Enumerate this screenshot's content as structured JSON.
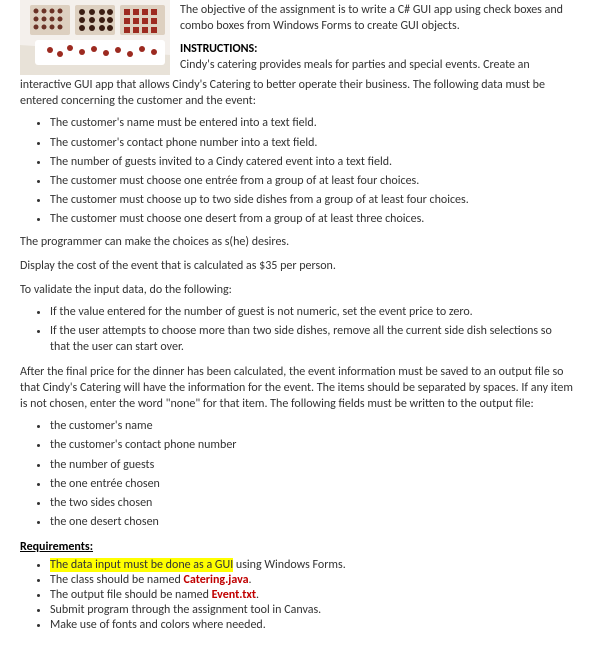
{
  "objective": {
    "text": "The objective of the assignment is to write a C# GUI app using check boxes and combo boxes from Windows Forms to create GUI objects."
  },
  "instructions": {
    "heading": "INSTRUCTIONS:",
    "line1": "Cindy's catering provides meals for parties and special events. Create an",
    "line2": "interactive GUI app that allows Cindy's Catering to better operate their business. The following data must be entered concerning the customer and the event:"
  },
  "data_points": [
    "The customer's name must be entered into a text field.",
    "The customer's contact phone number into a text field.",
    "The number of guests invited to a Cindy catered event into a text field.",
    "The customer must choose one entrée from a group of at least four choices.",
    "The customer must choose up to two side dishes from a group of at least four choices.",
    "The customer must choose one desert from a group of at least three choices."
  ],
  "programmer_note": "The programmer can make the choices as s(he) desires.",
  "display_cost": "Display the cost of the event that is calculated as $35 per person.",
  "validate_intro": "To validate the input data, do the following:",
  "validate_points": [
    "If the value entered for the number of guest is not numeric, set the event price to zero.",
    "If the user attempts to choose more than two side dishes, remove all the current side dish selections so that the user can start over."
  ],
  "after_price": "After the final price for the dinner has been calculated, the event information must be saved to an output file so that Cindy's Catering will have the information for the event. The items should be separated by spaces. If any item is not chosen, enter the word \"none\" for that item. The following fields must be written to the output file:",
  "output_fields": [
    "the customer's name",
    "the customer's contact phone number",
    "the number of guests",
    "the one entrée chosen",
    "the two sides chosen",
    "the one desert chosen"
  ],
  "requirements": {
    "heading": "Requirements:",
    "r1_hl": "The data input must be done as a GUI",
    "r1_rest": " using Windows Forms.",
    "r2_pre": "The class should be named ",
    "r2_red": "Catering.java",
    "r2_post": ".",
    "r3_pre": "The output file should be named ",
    "r3_red": "Event.txt",
    "r3_post": ".",
    "r4": "Submit program through the assignment tool in Canvas.",
    "r5": "Make use of fonts and colors where needed."
  }
}
